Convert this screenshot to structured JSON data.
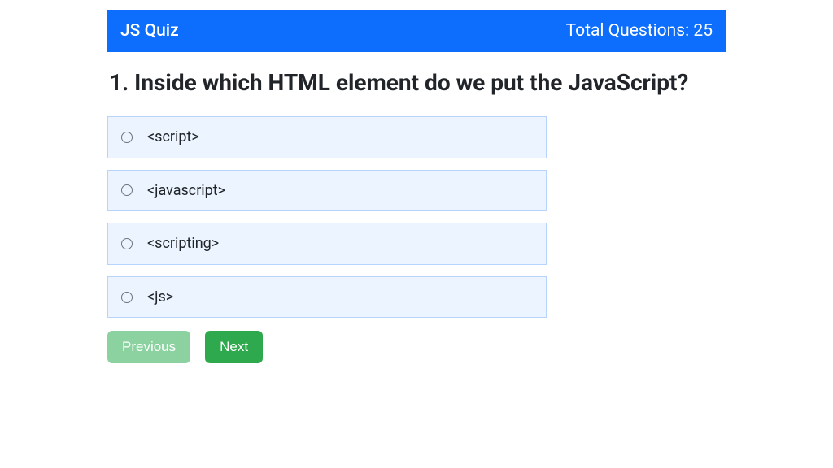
{
  "header": {
    "title": "JS Quiz",
    "total_label": "Total Questions: 25"
  },
  "question": {
    "number": "1.",
    "text": "Inside which HTML element do we put the JavaScript?"
  },
  "options": [
    {
      "label": "<script>"
    },
    {
      "label": "<javascript>"
    },
    {
      "label": "<scripting>"
    },
    {
      "label": "<js>"
    }
  ],
  "buttons": {
    "previous": "Previous",
    "next": "Next"
  }
}
